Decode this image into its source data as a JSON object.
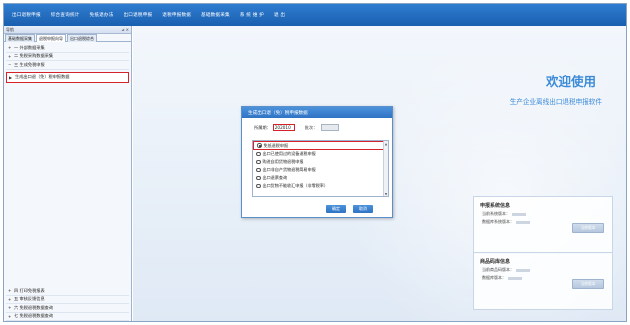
{
  "menu": [
    "出口退税申报",
    "综合查询统计",
    "免抵退办法",
    "出口退税申报",
    "退税申报数据",
    "基础数据采集",
    "系 统 维 护",
    "退 出"
  ],
  "left_panel": {
    "header": "导航",
    "tabs": [
      "基础数据采集",
      "退税申报向导",
      "出口退税综合"
    ],
    "tree_top": [
      "一 外部数据采集",
      "二 免税采购数据采集",
      "三 生成免税申报",
      "生成出口退（免）税申报数据"
    ],
    "tree_bottom": [
      "四 打印免税报表",
      "五 审核反馈信息",
      "六 免税退税数据查询",
      "七 免税退税数据查询"
    ]
  },
  "main": {
    "welcome": "欢迎使用",
    "subtitle": "生产企业离线出口退税申报软件",
    "declare_info": {
      "title": "申报系统信息",
      "rows": [
        "当前系统版本：",
        "数据库系统版本："
      ],
      "button": "当前版本"
    },
    "product_info": {
      "title": "商品码库信息",
      "rows": [
        "当前商品码版本：",
        "数据库版本："
      ],
      "button": "当前版本"
    }
  },
  "dialog": {
    "title": "生成出口退（免）税申报数据",
    "period_label": "所属期：",
    "period_value": "202010",
    "batch_label": "批次：",
    "options": [
      "免抵退税申报",
      "出口已使用过的设备退税申报",
      "购进自用货物退税申报",
      "出口非自产货物退税简易申报",
      "出口退票查询",
      "出口货物不能收汇申报（非零税率）"
    ],
    "selected_index": 0,
    "ok": "确定",
    "cancel": "取消"
  }
}
